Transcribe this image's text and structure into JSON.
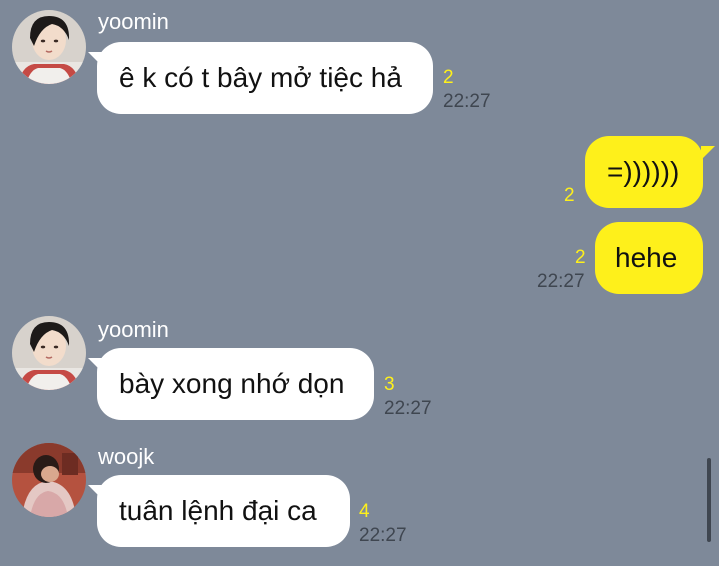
{
  "colors": {
    "background": "#7e8999",
    "incoming_bubble": "#ffffff",
    "outgoing_bubble": "#fef01b",
    "unread_count": "#fef01b",
    "timestamp": "#3f4650"
  },
  "messages": [
    {
      "sender": "yoomin",
      "text": "ê k có t bây mở tiệc hả",
      "unread": "2",
      "time": "22:27"
    },
    {
      "text": "=))))))",
      "unread": "2"
    },
    {
      "text": "hehe",
      "unread": "2",
      "time": "22:27"
    },
    {
      "sender": "yoomin",
      "text": "bày xong nhớ dọn",
      "unread": "3",
      "time": "22:27"
    },
    {
      "sender": "woojk",
      "text": "tuân lệnh đại ca",
      "unread": "4",
      "time": "22:27"
    }
  ]
}
